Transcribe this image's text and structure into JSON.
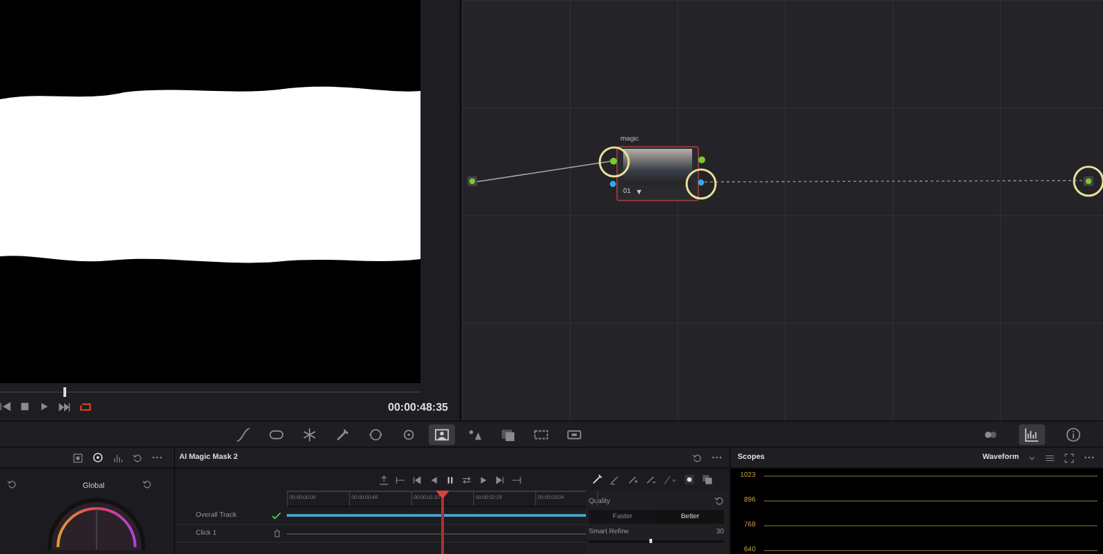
{
  "viewer": {
    "scrub": {
      "level": 0.15
    },
    "loop": {
      "on": true
    },
    "timecode": "00:00:48:35"
  },
  "node_editor": {
    "nodes": [
      {
        "label": "magic",
        "number": "01"
      }
    ]
  },
  "tools": [
    {
      "selected": false
    },
    {
      "selected": false
    },
    {
      "selected": false
    },
    {
      "selected": false
    },
    {
      "selected": false
    },
    {
      "selected": false
    },
    {
      "selected": true
    },
    {
      "selected": false
    },
    {
      "selected": false
    },
    {
      "selected": false
    },
    {
      "selected": false
    }
  ],
  "right_tools": [
    {
      "selected": false
    },
    {
      "selected": true
    },
    {
      "selected": false
    }
  ],
  "color_wheel": {
    "label": "Global"
  },
  "magic_mask": {
    "title": "AI Magic Mask 2",
    "ruler": [
      "00:00:00:00",
      "00:00:00:46",
      "00:00:01:32",
      "00:00:02:18",
      "00:00:03:04"
    ],
    "playhead": {
      "level": 0.52
    },
    "tracks": [
      {
        "name": "Overall Track",
        "kind": "check"
      },
      {
        "name": "Click 1",
        "kind": "trash"
      }
    ],
    "quality": {
      "label": "Quality",
      "options": [
        {
          "label": "Faster",
          "selected": false
        },
        {
          "label": "Better",
          "selected": true
        }
      ]
    },
    "smart_refine": {
      "label": "Smart Refine",
      "value": "30",
      "level": 0.45
    }
  },
  "scopes": {
    "title": "Scopes",
    "mode": "Waveform",
    "ticks": [
      "1023",
      "896",
      "768",
      "640"
    ]
  }
}
